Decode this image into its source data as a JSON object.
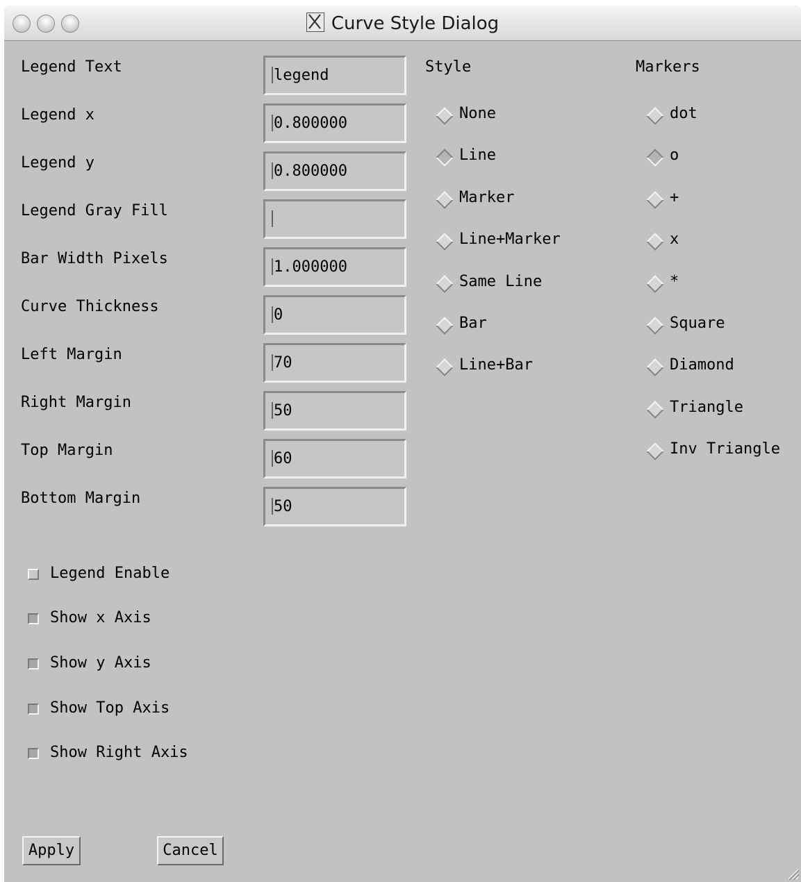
{
  "window": {
    "title": "Curve Style Dialog",
    "title_icon": "x11-icon"
  },
  "fields": [
    {
      "label": "Legend Text",
      "value": "legend"
    },
    {
      "label": "Legend x",
      "value": "0.800000"
    },
    {
      "label": "Legend y",
      "value": "0.800000"
    },
    {
      "label": "Legend Gray Fill",
      "value": ""
    },
    {
      "label": "Bar Width Pixels",
      "value": "1.000000"
    },
    {
      "label": "Curve Thickness",
      "value": "0"
    },
    {
      "label": "Left Margin",
      "value": "70"
    },
    {
      "label": "Right Margin",
      "value": "50"
    },
    {
      "label": "Top Margin",
      "value": "60"
    },
    {
      "label": "Bottom Margin",
      "value": "50"
    }
  ],
  "style": {
    "header": "Style",
    "options": [
      "None",
      "Line",
      "Marker",
      "Line+Marker",
      "Same Line",
      "Bar",
      "Line+Bar"
    ],
    "selected": "Line"
  },
  "markers": {
    "header": "Markers",
    "options": [
      "dot",
      "o",
      "+",
      "x",
      "*",
      "Square",
      "Diamond",
      "Triangle",
      "Inv Triangle"
    ],
    "selected": "o"
  },
  "checkboxes": [
    {
      "label": "Legend Enable",
      "checked": false
    },
    {
      "label": "Show x Axis",
      "checked": true
    },
    {
      "label": "Show y Axis",
      "checked": true
    },
    {
      "label": "Show Top Axis",
      "checked": true
    },
    {
      "label": "Show Right Axis",
      "checked": true
    }
  ],
  "buttons": {
    "apply": "Apply",
    "cancel": "Cancel"
  }
}
